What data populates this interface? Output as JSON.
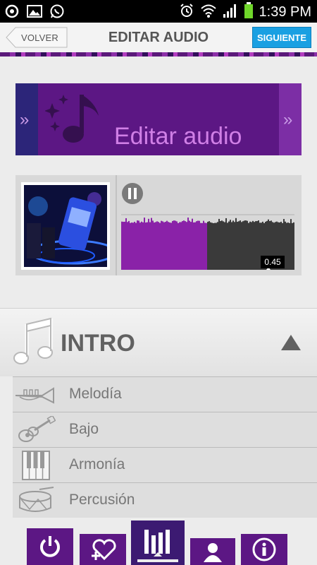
{
  "status_bar": {
    "time": "1:39 PM"
  },
  "header": {
    "back_label": "VOLVER",
    "title": "EDITAR AUDIO",
    "next_label": "SIGUIENTE"
  },
  "banner": {
    "title": "Editar audio",
    "left_chevron": "»",
    "right_chevron": "»"
  },
  "player": {
    "elapsed": "0.45",
    "progress": 0.49,
    "state": "playing"
  },
  "section": {
    "title": "INTRO",
    "items": [
      {
        "label": "Melodía",
        "icon": "trumpet-icon"
      },
      {
        "label": "Bajo",
        "icon": "guitar-icon"
      },
      {
        "label": "Armonía",
        "icon": "piano-icon"
      },
      {
        "label": "Percusión",
        "icon": "drum-icon"
      }
    ]
  },
  "bottom_nav": {
    "items": [
      "power-icon",
      "add-favorite-icon",
      "mixer-icon",
      "profile-icon",
      "info-icon"
    ],
    "active": "mixer-icon"
  },
  "colors": {
    "accent_purple": "#5c1784",
    "accent_blue": "#1aa0e2",
    "banner_text": "#d07fe6"
  }
}
